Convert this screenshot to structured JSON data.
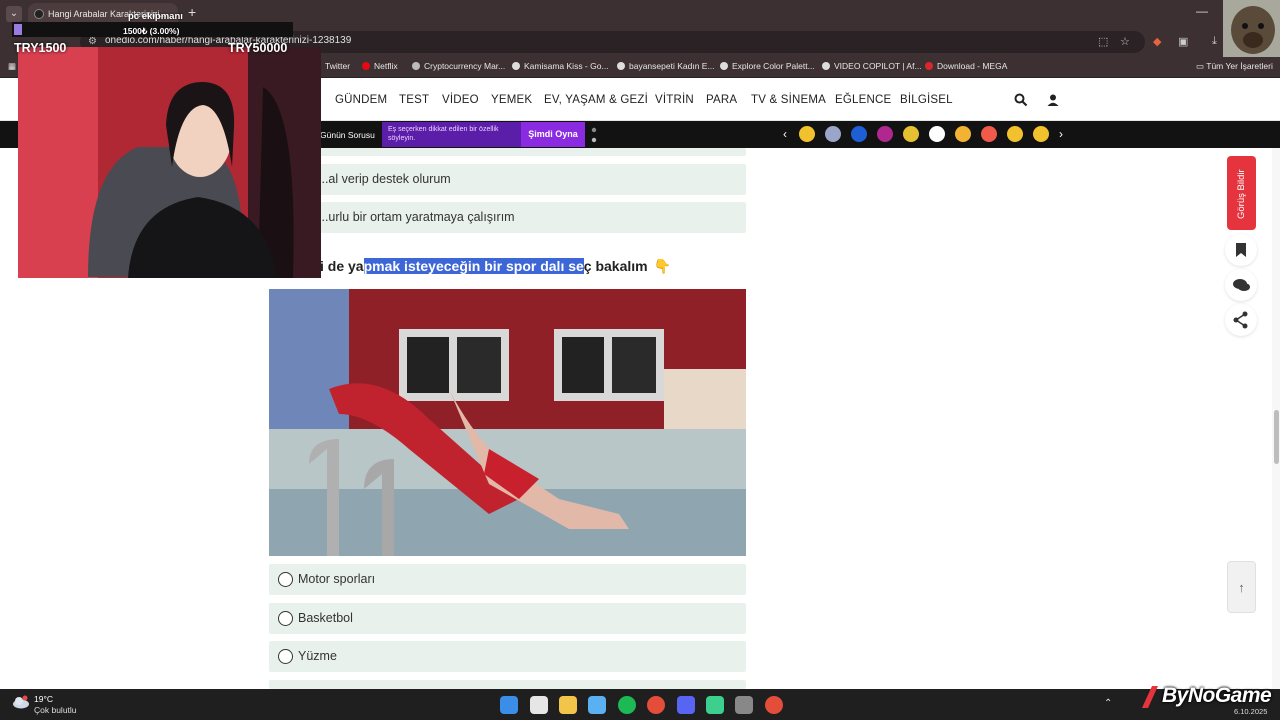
{
  "browser": {
    "tab_title": "Hangi Arabalar Karakterinizi...",
    "url": "onedio.com/haber/hangi-arabalar-karakterinizi-1238139",
    "bookmarks": [
      "Twitter",
      "Netflix",
      "Cryptocurrency Mar...",
      "Kamisama Kiss - Go...",
      "bayansepeti Kadın E...",
      "Explore Color Palett...",
      "VIDEO COPILOT | Af...",
      "Download - MEGA"
    ],
    "all_bookmarks": "Tüm Yer İşaretleri"
  },
  "nav": {
    "items": [
      "GÜNDEM",
      "TEST",
      "VİDEO",
      "YEMEK",
      "EV, YAŞAM & GEZİ",
      "VİTRİN",
      "PARA",
      "TV & SİNEMA",
      "EĞLENCE",
      "BİLGİSEL"
    ]
  },
  "promo": {
    "question_label": "Günün Sorusu",
    "banner_text": "Eş seçerken dikkat edilen bir özellik söyleyin.",
    "cta": "Şimdi Oyna",
    "emoji_colors": [
      "#f2c12e",
      "#9aa6c9",
      "#1f5fd6",
      "#b0288f",
      "#e7c032",
      "#ffffff",
      "#f2b233",
      "#f05a4a",
      "#f2c12e",
      "#f2c12e"
    ]
  },
  "content": {
    "prev_options": [
      "...al verip destek olurum",
      "...urlu bir ortam yaratmaya çalışırım"
    ],
    "question_pre": "i de ya",
    "question_highlight": "pmak isteyeceğin bir spor dalı se",
    "question_post": "ç bakalım",
    "question_emoji": "👇",
    "options": [
      "Motor sporları",
      "Basketbol",
      "Yüzme"
    ]
  },
  "side": {
    "feedback_label": "Görüş Bildir"
  },
  "stream": {
    "goal_title": "pc ekipmanı",
    "goal_progress": "1500₺ (3.00%)",
    "goal_current": "TRY1500",
    "goal_target": "TRY50000",
    "watermark": "ByNoGame"
  },
  "taskbar": {
    "temperature": "19°C",
    "condition": "Çok bulutlu",
    "date": "6.10.2025",
    "app_colors": [
      "#3b8ee8",
      "#e6e6e6",
      "#f2c44a",
      "#5ab0f0",
      "#1db954",
      "#e44d3a",
      "#5865f2",
      "#3ccf8e",
      "#888888",
      "#e44d3a"
    ]
  },
  "colors": {
    "accent_red": "#e6343e",
    "option_bg": "#e9f1ed",
    "highlight": "#3d66d6",
    "promo_purple": "#8a2be2"
  }
}
